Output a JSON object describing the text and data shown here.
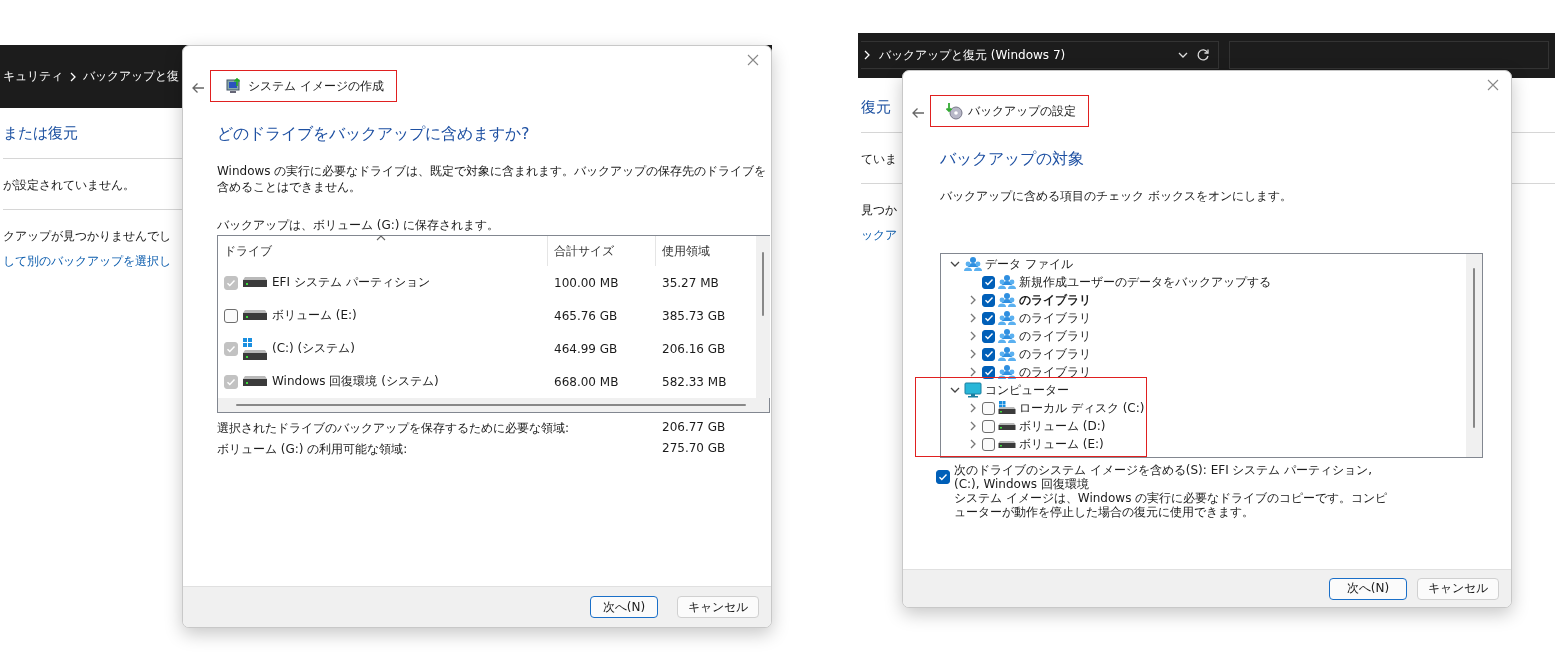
{
  "left_screenshot": {
    "background_window": {
      "kind": "breadcrumb",
      "path": [
        "キュリティ",
        "バックアップと復"
      ],
      "heading": "または復元",
      "status": "が設定されていません。",
      "message": "クアップが見つかりませんでし",
      "link": "して別のバックアップを選択し"
    },
    "dialog": {
      "kind": "drive-table",
      "title": "システム イメージの作成",
      "title_highlighted": true,
      "heading": "どのドライブをバックアップに含めますか?",
      "description": "Windows の実行に必要なドライブは、既定で対象に含まれます。バックアップの保存先のドライブを含めることはできません。",
      "destination": "バックアップは、ボリューム (G:) に保存されます。",
      "table": {
        "columns": [
          "ドライブ",
          "合計サイズ",
          "使用領域"
        ],
        "rows": [
          {
            "drive": "EFI システム パーティション",
            "kind": "drive",
            "checked": true,
            "disabled": true,
            "total_size": "100.00 MB",
            "used": "35.27 MB"
          },
          {
            "drive": "ボリューム (E:)",
            "kind": "drive",
            "checked": false,
            "disabled": false,
            "total_size": "465.76 GB",
            "used": "385.73 GB"
          },
          {
            "drive": "(C:) (システム)",
            "kind": "system-drive",
            "checked": true,
            "disabled": true,
            "total_size": "464.99 GB",
            "used": "206.16 GB"
          },
          {
            "drive": "Windows 回復環境 (システム)",
            "kind": "drive",
            "checked": true,
            "disabled": true,
            "total_size": "668.00 MB",
            "used": "582.33 MB"
          }
        ]
      },
      "summary": [
        {
          "label": "選択されたドライブのバックアップを保存するために必要な領域:",
          "value": "206.77 GB"
        },
        {
          "label": "ボリューム (G:) の利用可能な領域:",
          "value": "275.70 GB"
        }
      ],
      "buttons": [
        {
          "label": "次へ(N)",
          "default": true
        },
        {
          "label": "キャンセル",
          "default": false
        }
      ]
    }
  },
  "right_screenshot": {
    "background_window": {
      "kind": "address",
      "path": [
        "バックアップと復元 (Windows 7)"
      ],
      "heading": "復元",
      "status": "ていま",
      "message": "見つか",
      "link": "ックア"
    },
    "dialog": {
      "kind": "tree",
      "title": "バックアップの設定",
      "title_highlighted": true,
      "heading": "バックアップの対象",
      "description": "バックアップに含める項目のチェック ボックスをオンにします。",
      "tree": [
        {
          "label": "データ ファイル",
          "kind": "users",
          "expanded": true,
          "highlighted": false,
          "children": [
            {
              "label": "新規作成ユーザーのデータをバックアップする",
              "kind": "users",
              "checked": true,
              "bold": false
            },
            {
              "label": "のライブラリ",
              "kind": "users",
              "checked": true,
              "expanded": false,
              "bold": true
            },
            {
              "label": "のライブラリ",
              "kind": "users",
              "checked": true,
              "expanded": false,
              "bold": false
            },
            {
              "label": "のライブラリ",
              "kind": "users",
              "checked": true,
              "expanded": false,
              "bold": false
            },
            {
              "label": "のライブラリ",
              "kind": "users",
              "checked": true,
              "expanded": false,
              "bold": false
            },
            {
              "label": "のライブラリ",
              "kind": "users",
              "checked": true,
              "expanded": false,
              "bold": false
            }
          ]
        },
        {
          "label": "コンピューター",
          "kind": "computer",
          "expanded": true,
          "highlighted": true,
          "children": [
            {
              "label": "ローカル ディスク (C:)",
              "kind": "system-drive",
              "checked": false,
              "expanded": false,
              "bold": false
            },
            {
              "label": "ボリューム (D:)",
              "kind": "drive",
              "checked": false,
              "expanded": false,
              "bold": false
            },
            {
              "label": "ボリューム (E:)",
              "kind": "drive",
              "checked": false,
              "expanded": false,
              "bold": false
            }
          ]
        }
      ],
      "system_image": {
        "checked": true,
        "label": "次のドライブのシステム イメージを含める(S): EFI システム パーティション, (C:), Windows 回復環境",
        "description": "システム イメージは、Windows の実行に必要なドライブのコピーです。コンピューターが動作を停止した場合の復元に使用できます。"
      },
      "buttons": [
        {
          "label": "次へ(N)",
          "default": true
        },
        {
          "label": "キャンセル",
          "default": false
        }
      ]
    }
  }
}
